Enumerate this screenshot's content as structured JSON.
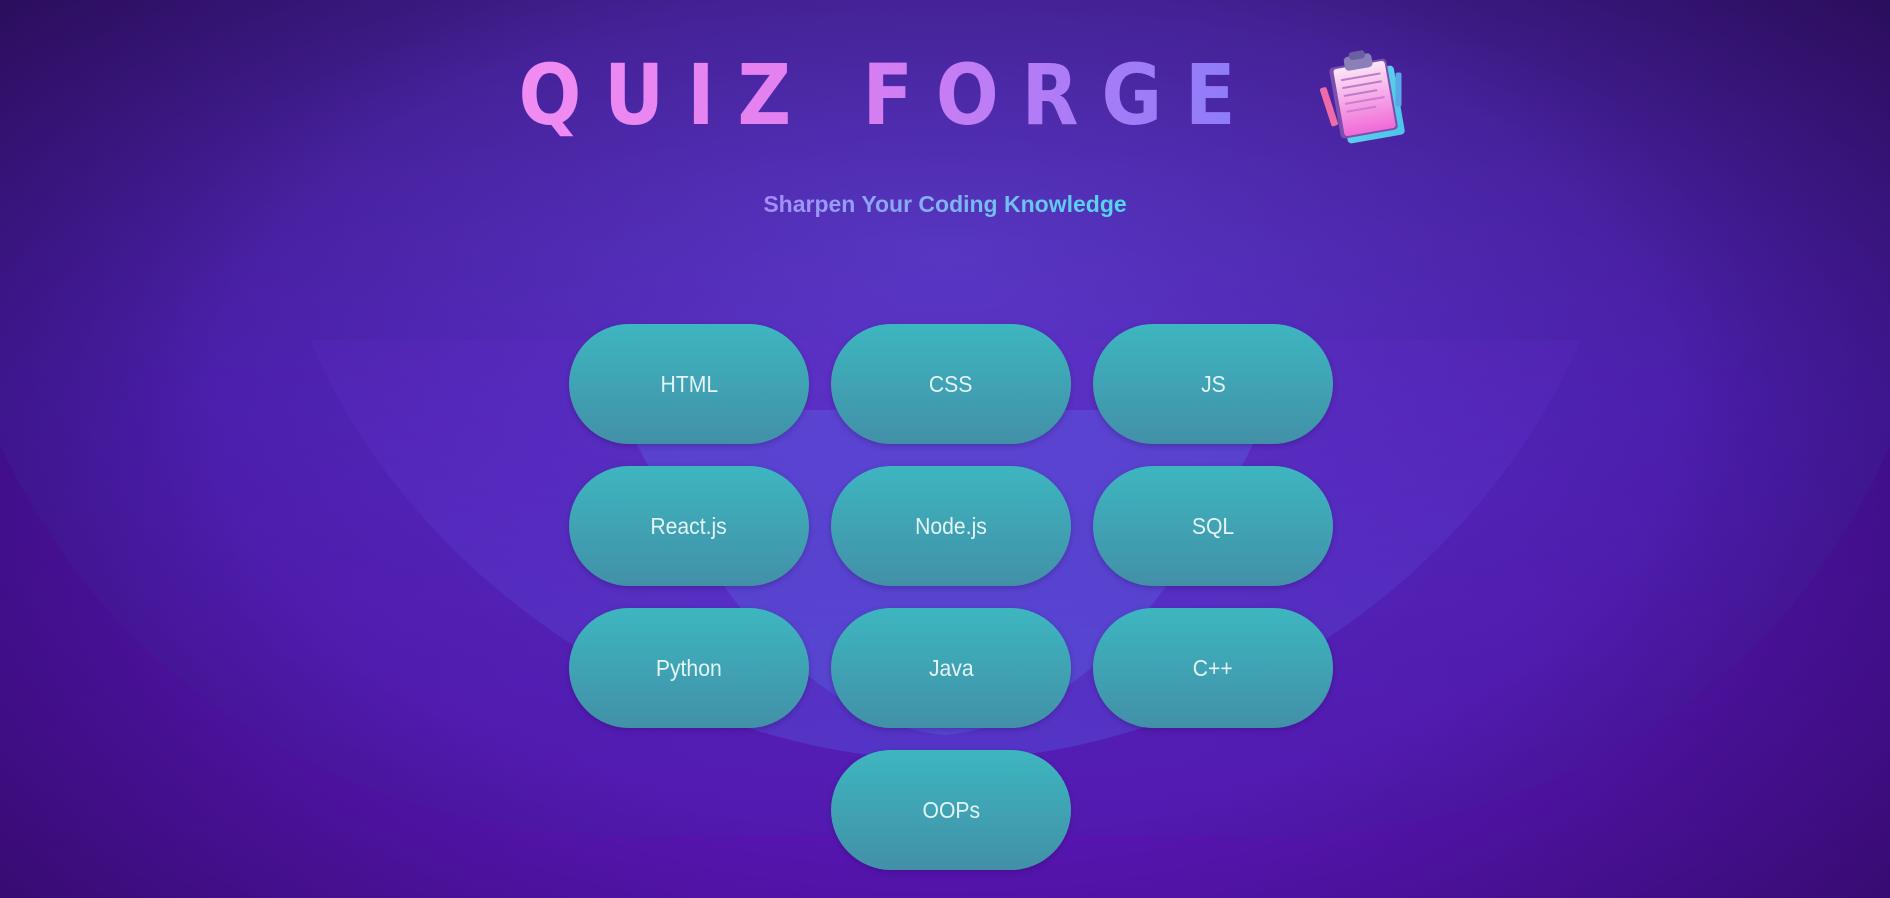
{
  "header": {
    "title": "QUIZ FORGE",
    "subtitle": "Sharpen Your Coding Knowledge",
    "logo_icon": "clipboard-quiz-icon"
  },
  "topics": [
    {
      "label": "HTML"
    },
    {
      "label": "CSS"
    },
    {
      "label": "JS"
    },
    {
      "label": "React.js"
    },
    {
      "label": "Node.js"
    },
    {
      "label": "SQL"
    },
    {
      "label": "Python"
    },
    {
      "label": "Java"
    },
    {
      "label": "C++"
    },
    {
      "label": "OOPs"
    }
  ],
  "colors": {
    "background": "#4a12a0",
    "title_gradient_start": "#f08cf2",
    "title_gradient_end": "#8a7cf8",
    "subtitle_gradient_start": "#a48cf8",
    "subtitle_gradient_end": "#52d7ee",
    "button_top": "#3db6c0",
    "button_bottom": "#4290a8",
    "button_text": "#e4f4f7"
  }
}
